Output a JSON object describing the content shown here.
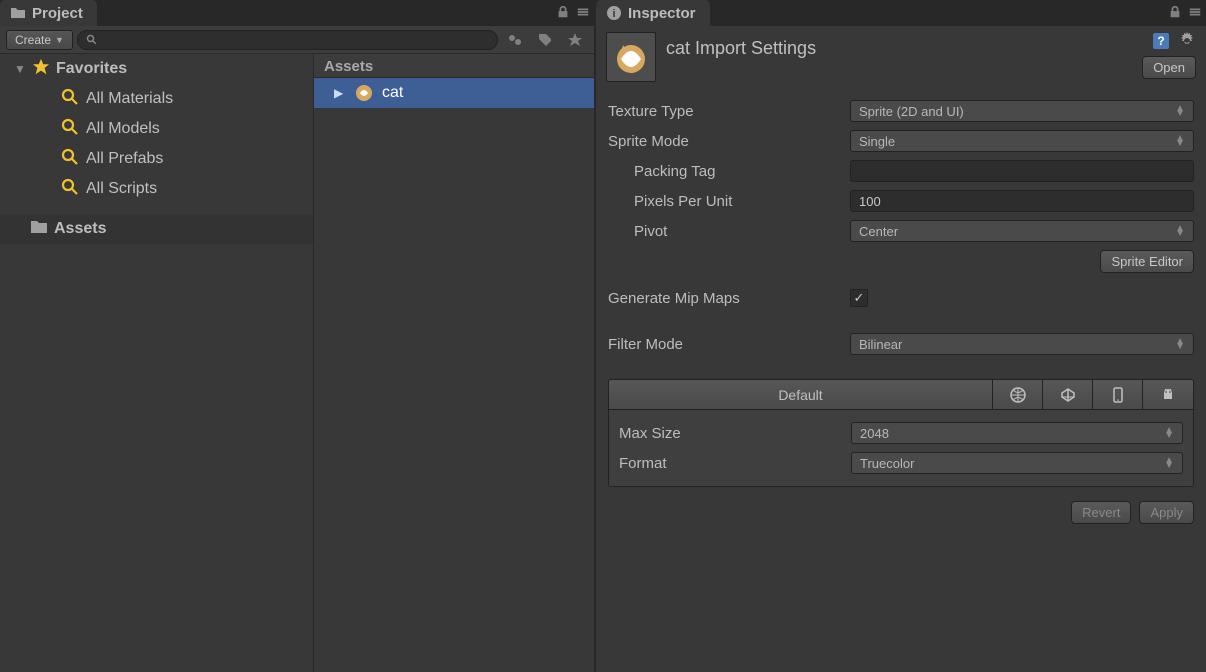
{
  "project": {
    "tab": "Project",
    "create": "Create",
    "favorites_label": "Favorites",
    "favorites": [
      "All Materials",
      "All Models",
      "All Prefabs",
      "All Scripts"
    ],
    "assets_label": "Assets",
    "list_header": "Assets",
    "selected_item": "cat"
  },
  "inspector": {
    "tab": "Inspector",
    "title": "cat Import Settings",
    "open": "Open",
    "texture_type": {
      "label": "Texture Type",
      "value": "Sprite (2D and UI)"
    },
    "sprite_mode": {
      "label": "Sprite Mode",
      "value": "Single"
    },
    "packing_tag": {
      "label": "Packing Tag",
      "value": ""
    },
    "ppu": {
      "label": "Pixels Per Unit",
      "value": "100"
    },
    "pivot": {
      "label": "Pivot",
      "value": "Center"
    },
    "sprite_editor": "Sprite Editor",
    "mipmaps": {
      "label": "Generate Mip Maps",
      "checked": true
    },
    "filter_mode": {
      "label": "Filter Mode",
      "value": "Bilinear"
    },
    "platform_default": "Default",
    "max_size": {
      "label": "Max Size",
      "value": "2048"
    },
    "format": {
      "label": "Format",
      "value": "Truecolor"
    },
    "revert": "Revert",
    "apply": "Apply"
  }
}
